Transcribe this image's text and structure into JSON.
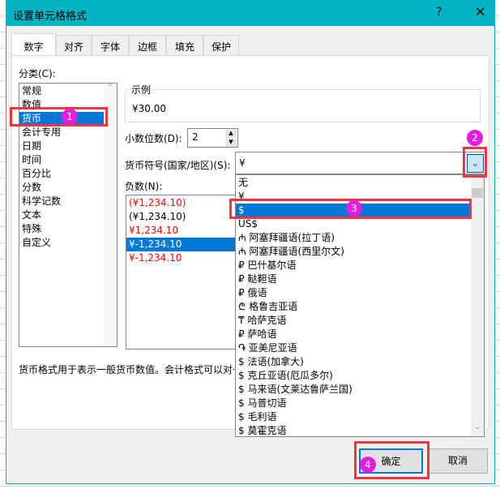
{
  "title": "设置单元格格式",
  "help": "?",
  "close": "✕",
  "tabs": [
    "数字",
    "对齐",
    "字体",
    "边框",
    "填充",
    "保护"
  ],
  "category_label": "分类(C):",
  "categories": [
    "常规",
    "数值",
    "货币",
    "会计专用",
    "日期",
    "时间",
    "百分比",
    "分数",
    "科学记数",
    "文本",
    "特殊",
    "自定义"
  ],
  "sample_label": "示例",
  "sample_value": "¥30.00",
  "decimal_label": "小数位数(D):",
  "decimal_value": "2",
  "symbol_label": "货币符号(国家/地区)(S):",
  "symbol_value": "¥",
  "negative_label": "负数(N):",
  "negatives": [
    {
      "t": "(¥1,234.10)",
      "red": true
    },
    {
      "t": "(¥1,234.10)",
      "red": false
    },
    {
      "t": "¥1,234.10",
      "red": true
    },
    {
      "t": "¥-1,234.10",
      "red": false
    },
    {
      "t": "¥-1,234.10",
      "red": true
    }
  ],
  "symbol_options": [
    "无",
    "¥",
    "$",
    "US$",
    "₼ 阿塞拜疆语(拉丁语)",
    "₼ 阿塞拜疆语(西里尔文)",
    "₽ 巴什基尔语",
    "₽ 鞑靼语",
    "₽ 俄语",
    "₾ 格鲁吉亚语",
    "₸ 哈萨克语",
    "₽ 萨哈语",
    "֏ 亚美尼亚语",
    "$ 法语(加拿大)",
    "$ 克丘亚语(厄瓜多尔)",
    "$ 马来语(文莱达鲁萨兰国)",
    "$ 马普切语",
    "$ 毛利语",
    "$ 莫霍克语"
  ],
  "description": "货币格式用于表示一般货币数值。会计格式可以对一",
  "ok": "确定",
  "cancel": "取消",
  "steps": [
    "1",
    "2",
    "3",
    "4"
  ],
  "colors": {
    "titlebar": "#00b4c4",
    "selection": "#0078d7",
    "annotation": "#f5333f",
    "badge": "#e41de4"
  }
}
